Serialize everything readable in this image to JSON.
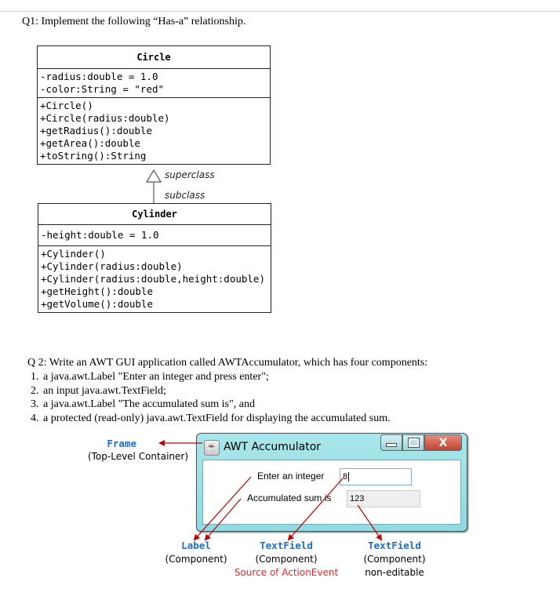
{
  "q1": {
    "heading": "Q1: Implement the following “Has-a” relationship."
  },
  "uml": {
    "circle": {
      "name": "Circle",
      "attributes": [
        "-radius:double = 1.0",
        "-color:String = \"red\""
      ],
      "methods": [
        "+Circle()",
        "+Circle(radius:double)",
        "+getRadius():double",
        "+getArea():double",
        "+toString():String"
      ]
    },
    "relation": {
      "superclass_label": "superclass",
      "subclass_label": "subclass"
    },
    "cylinder": {
      "name": "Cylinder",
      "attributes": [
        "-height:double = 1.0"
      ],
      "methods": [
        "+Cylinder()",
        "+Cylinder(radius:double)",
        "+Cylinder(radius:double,height:double)",
        "+getHeight():double",
        "+getVolume():double"
      ]
    }
  },
  "q2": {
    "intro": "Q 2: Write an AWT GUI application called AWTAccumulator, which has four components:",
    "items": [
      "a java.awt.Label \"Enter an integer and press enter\";",
      "an input java.awt.TextField;",
      "a java.awt.Label \"The accumulated sum is\", and",
      "a protected (read-only) java.awt.TextField for displaying the accumulated sum."
    ]
  },
  "figure": {
    "window": {
      "title": "AWT Accumulator",
      "icon": "java-cup-icon",
      "label_input": "Enter an integer",
      "input_value": "8",
      "label_sum": "Accumulated sum is",
      "sum_value": "123",
      "buttons": [
        "minimize",
        "maximize",
        "close"
      ],
      "close_glyph": "X"
    },
    "annotations": {
      "frame": {
        "code": "Frame",
        "desc": "(Top-Level Container)"
      },
      "label": {
        "code": "Label",
        "desc": "(Component)"
      },
      "textfield_input": {
        "code": "TextField",
        "desc": "(Component)",
        "note": "Source of ActionEvent"
      },
      "textfield_output": {
        "code": "TextField",
        "desc": "(Component)",
        "note": "non-editable"
      }
    },
    "colors": {
      "annotation_code": "#1a6fcf",
      "arrow": "#c00000",
      "highlight_note": "#ff2020"
    }
  }
}
